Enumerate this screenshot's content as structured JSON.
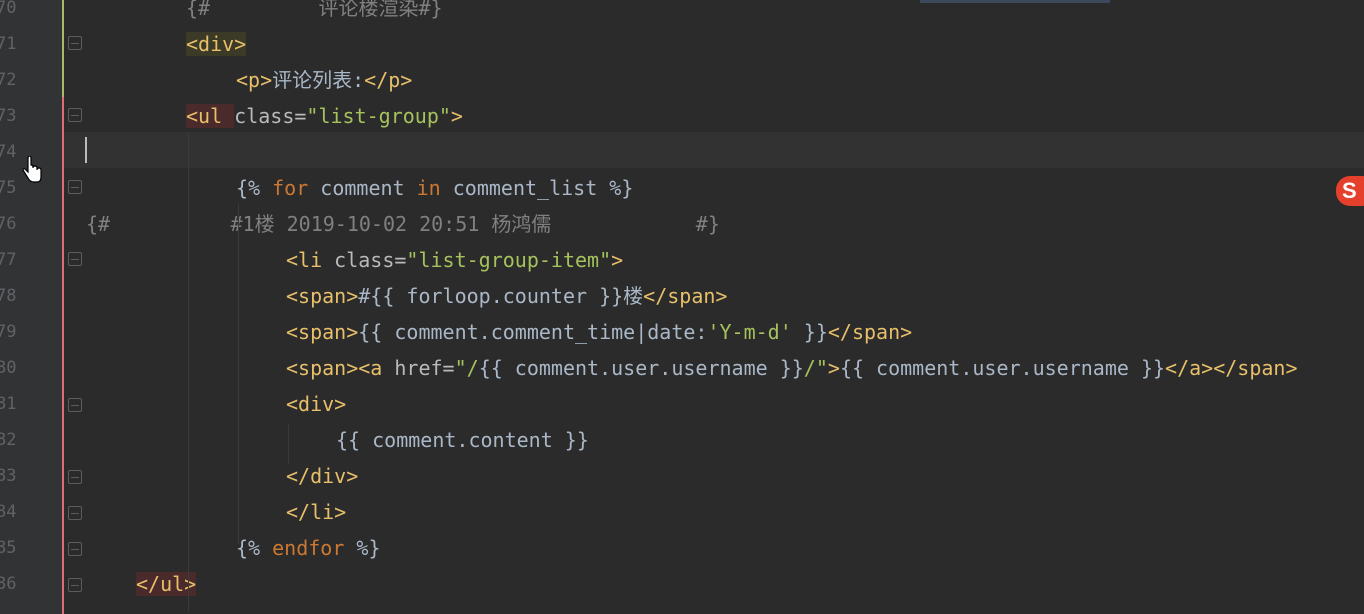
{
  "editor": {
    "line_numbers": [
      "70",
      "71",
      "72",
      "73",
      "74",
      "75",
      "76",
      "77",
      "78",
      "79",
      "80",
      "81",
      "82",
      "83",
      "84",
      "85",
      "86"
    ],
    "lines": [
      {
        "parts": [
          {
            "t": "{#         评论楼渲染#}",
            "c": "comment"
          }
        ]
      },
      {
        "parts": [
          {
            "t": "<div>",
            "c": "tag tag-hl-div"
          }
        ]
      },
      {
        "parts": [
          {
            "t": "<p>",
            "c": "tag"
          },
          {
            "t": "评论列表:",
            "c": "tpl"
          },
          {
            "t": "</p>",
            "c": "tag"
          }
        ]
      },
      {
        "parts": [
          {
            "t": "<ul ",
            "c": "tag tag-hl-ul"
          },
          {
            "t": "class=",
            "c": "attr"
          },
          {
            "t": "\"list-group\"",
            "c": "str"
          },
          {
            "t": ">",
            "c": "tag"
          }
        ]
      },
      {
        "parts": []
      },
      {
        "parts": [
          {
            "t": "{% ",
            "c": "tpl"
          },
          {
            "t": "for",
            "c": "kw"
          },
          {
            "t": " comment ",
            "c": "tpl"
          },
          {
            "t": "in",
            "c": "kw"
          },
          {
            "t": " comment_list %}",
            "c": "tpl"
          }
        ]
      },
      {
        "parts": [
          {
            "t": "{#          #1楼 2019-10-02 20:51 杨鸿儒            #}",
            "c": "comment"
          }
        ]
      },
      {
        "parts": [
          {
            "t": "<li ",
            "c": "tag"
          },
          {
            "t": "class=",
            "c": "attr"
          },
          {
            "t": "\"list-group-item\"",
            "c": "str"
          },
          {
            "t": ">",
            "c": "tag"
          }
        ]
      },
      {
        "parts": [
          {
            "t": "<span>",
            "c": "tag"
          },
          {
            "t": "#{{ forloop.counter }}楼",
            "c": "tpl"
          },
          {
            "t": "</span>",
            "c": "tag"
          }
        ]
      },
      {
        "parts": [
          {
            "t": "<span>",
            "c": "tag"
          },
          {
            "t": "{{ comment.comment_time|date:",
            "c": "tpl"
          },
          {
            "t": "'Y-m-d'",
            "c": "sq"
          },
          {
            "t": " }}",
            "c": "tpl"
          },
          {
            "t": "</span>",
            "c": "tag"
          }
        ]
      },
      {
        "parts": [
          {
            "t": "<span>",
            "c": "tag"
          },
          {
            "t": "<a ",
            "c": "tag"
          },
          {
            "t": "href=",
            "c": "attr"
          },
          {
            "t": "\"/",
            "c": "str"
          },
          {
            "t": "{{ comment.user.username }}",
            "c": "tpl"
          },
          {
            "t": "/\"",
            "c": "str"
          },
          {
            "t": ">",
            "c": "tag"
          },
          {
            "t": "{{ comment.user.username }}",
            "c": "tpl"
          },
          {
            "t": "</a></span>",
            "c": "tag"
          }
        ]
      },
      {
        "parts": [
          {
            "t": "<div>",
            "c": "tag"
          }
        ]
      },
      {
        "parts": [
          {
            "t": "{{ comment.content }}",
            "c": "tpl"
          }
        ]
      },
      {
        "parts": [
          {
            "t": "</div>",
            "c": "tag"
          }
        ]
      },
      {
        "parts": [
          {
            "t": "</li>",
            "c": "tag"
          }
        ]
      },
      {
        "parts": [
          {
            "t": "{% ",
            "c": "tpl"
          },
          {
            "t": "endfor",
            "c": "kw"
          },
          {
            "t": " %}",
            "c": "tpl"
          }
        ]
      },
      {
        "parts": [
          {
            "t": "</ul>",
            "c": "tag tag-hl-ul"
          }
        ]
      }
    ]
  },
  "colors": {
    "background": "#2b2b2b",
    "gutter": "#313335",
    "tag": "#e8bf6a",
    "string": "#a5c25c",
    "keyword": "#cc7832",
    "comment": "#808080",
    "text": "#a9b7c6"
  },
  "badge": {
    "label": "S",
    "icon": "sogou-ime-icon"
  }
}
